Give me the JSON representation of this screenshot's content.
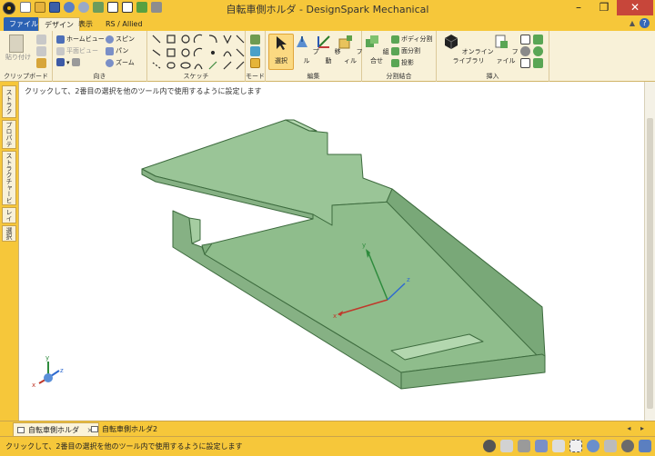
{
  "window": {
    "title": "自転車側ホルダ - DesignSpark Mechanical",
    "minimize": "–",
    "restore": "❐",
    "close": "✕"
  },
  "ribbon_tabs": [
    "ファイル(F)",
    "デザイン",
    "表示",
    "RS / Allied"
  ],
  "ribbon": {
    "clipboard": {
      "label": "クリップボード",
      "paste": "貼り付け"
    },
    "orient": {
      "label": "向き",
      "home": "ホームビュー",
      "plane": "平面ビュー",
      "spin": "スピン",
      "pan": "パン",
      "zoom": "ズーム"
    },
    "sketch": {
      "label": "スケッチ"
    },
    "mode": {
      "label": "モード"
    },
    "edit": {
      "label": "編集",
      "select": "選択",
      "pull": "プル",
      "move": "移動",
      "fill": "フィル"
    },
    "intersect": {
      "label": "分割結合",
      "combine": "組合せ",
      "split_body": "ボディ分割",
      "split_face": "面分割",
      "project": "投影"
    },
    "insert": {
      "label": "挿入",
      "online": "オンラインライブラリ",
      "file": "ファイル"
    }
  },
  "side_tabs": [
    "ストラクチャー - 選択",
    "プロパティ",
    "ストラクチャービュー",
    "レイヤ",
    "選択"
  ],
  "viewport": {
    "hint": "クリックして、2番目の選択を他のツール内で使用するように設定します",
    "axis_x": "x",
    "axis_y": "y",
    "axis_z": "z"
  },
  "doc_tabs": [
    {
      "label": "自転車側ホルダ",
      "close": "×"
    },
    {
      "label": "自転車側ホルダ2"
    }
  ],
  "status": {
    "text": "クリックして、2番目の選択を他のツール内で使用するように設定します"
  },
  "colors": {
    "chrome": "#f6c73a",
    "ribbon": "#f8f1d8",
    "part_face": "#9ac597",
    "part_side": "#86b184",
    "part_edge": "#3d6b3e"
  }
}
